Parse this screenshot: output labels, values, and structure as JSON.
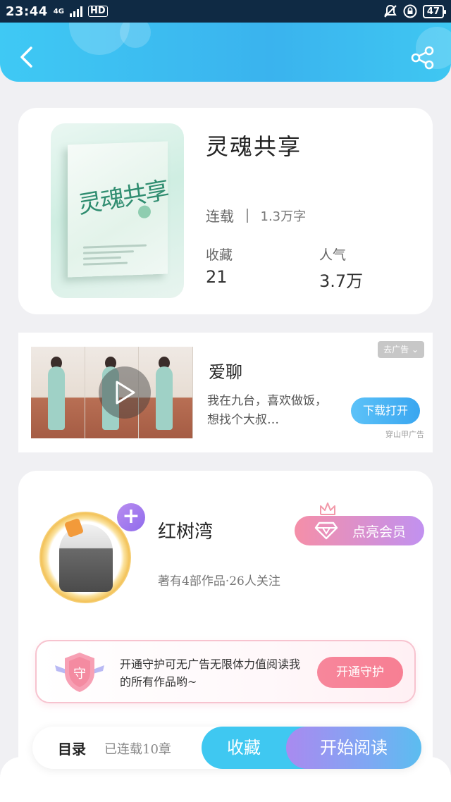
{
  "status_bar": {
    "time": "23:44",
    "network": "4G",
    "hd": "HD",
    "battery": "47"
  },
  "book": {
    "cover_title": "灵魂共享",
    "title": "灵魂共享",
    "status": "连载",
    "word_count": "1.3万字",
    "favorites_label": "收藏",
    "favorites_value": "21",
    "popularity_label": "人气",
    "popularity_value": "3.7万"
  },
  "ad": {
    "title": "爱聊",
    "description": "我在九台，喜欢做饭，想找个大叔…",
    "remove_label": "去广告 ⌄",
    "download_label": "下载打开",
    "source": "穿山甲广告"
  },
  "author": {
    "name": "红树湾",
    "info": "著有4部作品·26人关注",
    "follow_icon": "+",
    "vip_label": "点亮会员",
    "guard_shield_text": "守",
    "guard_text": "开通守护可无广告无限体力值阅读我的所有作品哟~",
    "guard_button": "开通守护"
  },
  "bottom_bar": {
    "toc_label": "目录",
    "chapter_count": "已连载10章",
    "favorite_button": "收藏",
    "read_button": "开始阅读"
  }
}
